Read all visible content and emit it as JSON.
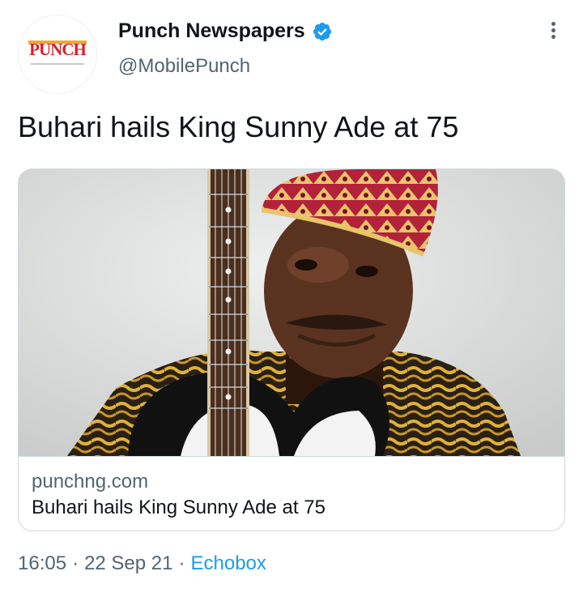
{
  "author": {
    "display_name": "Punch Newspapers",
    "handle": "@MobilePunch",
    "avatar_logo_text": "PUNCH",
    "verified_icon": "verified-badge-icon",
    "more_icon": "more-options-icon"
  },
  "tweet": {
    "text": "Buhari hails King Sunny Ade at 75"
  },
  "card": {
    "image_subject": "man in embroidered cap holding electric guitar",
    "domain": "punchng.com",
    "title": "Buhari hails King Sunny Ade at 75"
  },
  "meta": {
    "time": "16:05",
    "separator": "·",
    "date": "22 Sep 21",
    "source": "Echobox"
  },
  "colors": {
    "text_primary": "#0f1419",
    "text_secondary": "#536471",
    "accent": "#1d9bf0",
    "brand_red": "#d3212a",
    "border": "#cfd9de"
  }
}
